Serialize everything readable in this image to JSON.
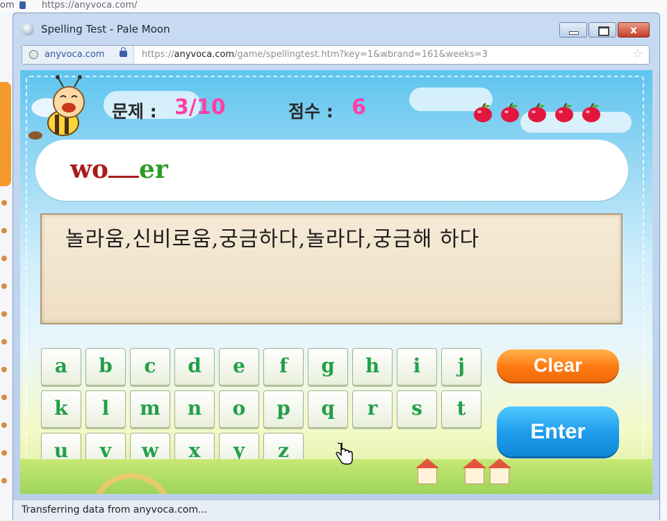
{
  "background": {
    "url": "https://anyvoca.com/",
    "left_fragment": "om"
  },
  "window": {
    "title": "Spelling Test - Pale Moon",
    "min_glyph": "",
    "max_glyph": "",
    "close_glyph": "x"
  },
  "addressbar": {
    "site_identity": "anyvoca.com",
    "url_prefix": "https://",
    "url_host": "anyvoca.com",
    "url_path": "/game/spellingtest.htm?key=1&wbrand=161&weeks=3"
  },
  "game": {
    "question_label": "문제 :",
    "question_value": "3/10",
    "score_label": "점수 :",
    "score_value": "6",
    "apples_count": 5,
    "word_prefix": "wo",
    "word_suffix": "er",
    "meaning": "놀라움,신비로움,궁금하다,놀라다,궁금해 하다",
    "keys": [
      "a",
      "b",
      "c",
      "d",
      "e",
      "f",
      "g",
      "h",
      "i",
      "j",
      "k",
      "l",
      "m",
      "n",
      "o",
      "p",
      "q",
      "r",
      "s",
      "t",
      "u",
      "v",
      "w",
      "x",
      "y",
      "z"
    ],
    "clear_label": "Clear",
    "enter_label": "Enter"
  },
  "status": {
    "text": "Transferring data from anyvoca.com..."
  },
  "colors": {
    "accent_pink": "#ff3fa7",
    "word_green": "#2d9a27",
    "word_red": "#a81c1c",
    "key_green": "#22a04a",
    "clear_orange": "#ff7a13",
    "enter_blue": "#1d9bea"
  }
}
